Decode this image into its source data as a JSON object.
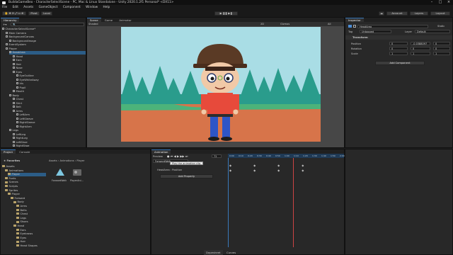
{
  "window": {
    "title": "BuildaGameBeo - CharacterSelectScene - PC, Mac & Linux Standalone - Unity 2020.1.2f1 Personal* <DX11>"
  },
  "menu": [
    "File",
    "Edit",
    "Assets",
    "GameObject",
    "Component",
    "Window",
    "Help"
  ],
  "toolbar": {
    "pivot": "Pivot",
    "local": "Local",
    "account": "Account",
    "layers": "Layers",
    "layout": "Layout"
  },
  "hierarchy": {
    "tab": "Hierarchy",
    "search_placeholder": "All",
    "rows": [
      {
        "label": "CharacterSelectScene*",
        "depth": 0
      },
      {
        "label": "Main Camera",
        "depth": 1
      },
      {
        "label": "BackgroundCanvas",
        "depth": 1
      },
      {
        "label": "BackgroundImage",
        "depth": 2
      },
      {
        "label": "EventSystem",
        "depth": 1
      },
      {
        "label": "Player",
        "depth": 1
      },
      {
        "label": "HeadArea",
        "depth": 2
      },
      {
        "label": "Head",
        "depth": 3
      },
      {
        "label": "Ears",
        "depth": 3
      },
      {
        "label": "Hair",
        "depth": 3
      },
      {
        "label": "Nose",
        "depth": 3
      },
      {
        "label": "Eyes",
        "depth": 3
      },
      {
        "label": "EyeOutline",
        "depth": 4
      },
      {
        "label": "EyeWhiteAway",
        "depth": 4
      },
      {
        "label": "Iris",
        "depth": 4
      },
      {
        "label": "Pupil",
        "depth": 4
      },
      {
        "label": "Mouth",
        "depth": 3
      },
      {
        "label": "Body",
        "depth": 2
      },
      {
        "label": "Chest",
        "depth": 3
      },
      {
        "label": "Shirt",
        "depth": 3
      },
      {
        "label": "Belt",
        "depth": 3
      },
      {
        "label": "Arms",
        "depth": 3
      },
      {
        "label": "LeftArm",
        "depth": 4
      },
      {
        "label": "LeftSleeve",
        "depth": 4
      },
      {
        "label": "RightSleeve",
        "depth": 4
      },
      {
        "label": "RightArm",
        "depth": 4
      },
      {
        "label": "Legs",
        "depth": 2
      },
      {
        "label": "LeftLeg",
        "depth": 3
      },
      {
        "label": "RightLeg",
        "depth": 3
      },
      {
        "label": "LeftShoe",
        "depth": 3
      },
      {
        "label": "RightShoe",
        "depth": 3
      }
    ]
  },
  "scene": {
    "tabs": [
      "Scene",
      "Game",
      "Animator"
    ],
    "shading": "Shaded",
    "mode": "2D",
    "gizmos": "Gizmos",
    "all": "All"
  },
  "inspector": {
    "tab": "Inspector",
    "object_name": "HeadArea",
    "static": "Static",
    "tag_label": "Tag",
    "tag": "Untagged",
    "layer_label": "Layer",
    "layer": "Default",
    "transform": "Transform",
    "position": {
      "label": "Position",
      "x": "0",
      "y": "-0.0388097",
      "z": "0"
    },
    "rotation": {
      "label": "Rotation",
      "x": "0",
      "y": "0",
      "z": "0"
    },
    "scale": {
      "label": "Scale",
      "x": "1",
      "y": "1",
      "z": "1"
    },
    "add_component": "Add Component"
  },
  "project": {
    "tabs": [
      "Project",
      "Console"
    ],
    "favorites": "Favorites",
    "breadcrumb": [
      "Assets",
      "Animations",
      "Player"
    ],
    "tree": [
      {
        "label": "Assets",
        "depth": 0
      },
      {
        "label": "Animations",
        "depth": 1
      },
      {
        "label": "Player",
        "depth": 2
      },
      {
        "label": "Fonts",
        "depth": 1
      },
      {
        "label": "Scenes",
        "depth": 1
      },
      {
        "label": "Scripts",
        "depth": 1
      },
      {
        "label": "Sprites",
        "depth": 1
      },
      {
        "label": "Player",
        "depth": 2
      },
      {
        "label": "Forward",
        "depth": 3
      },
      {
        "label": "Body",
        "depth": 4
      },
      {
        "label": "Arms",
        "depth": 5
      },
      {
        "label": "Belts",
        "depth": 5
      },
      {
        "label": "Chest",
        "depth": 5
      },
      {
        "label": "Legs",
        "depth": 5
      },
      {
        "label": "Shoes",
        "depth": 5
      },
      {
        "label": "Head",
        "depth": 4
      },
      {
        "label": "Ears",
        "depth": 5
      },
      {
        "label": "Eyebrows",
        "depth": 5
      },
      {
        "label": "Eyes",
        "depth": 5
      },
      {
        "label": "Hair",
        "depth": 5
      },
      {
        "label": "Head Shapes",
        "depth": 5
      }
    ],
    "assets": [
      {
        "label": "ForwardWalk"
      },
      {
        "label": "PlayerAni..."
      }
    ]
  },
  "animation": {
    "tab": "Animation",
    "preview": "Preview",
    "frame": "72",
    "clip": "ForwardWalk",
    "tooltip": "Play the animation clip.",
    "property": "HeadArea : Position",
    "add_property": "Add Property",
    "timeline": [
      "0:00",
      "0:10",
      "0:20",
      "0:30",
      "0:40",
      "0:50",
      "1:00",
      "1:10",
      "1:20",
      "1:30",
      "1:40",
      "1:50",
      "2:00"
    ],
    "bottom_tabs": [
      "Dopesheet",
      "Curves"
    ]
  },
  "colors": {
    "accent": "#3a79bb",
    "selection": "#2c5d87",
    "sky": "#a9dde5",
    "ground": "#d7744a",
    "trees": "#2a9c8c"
  }
}
